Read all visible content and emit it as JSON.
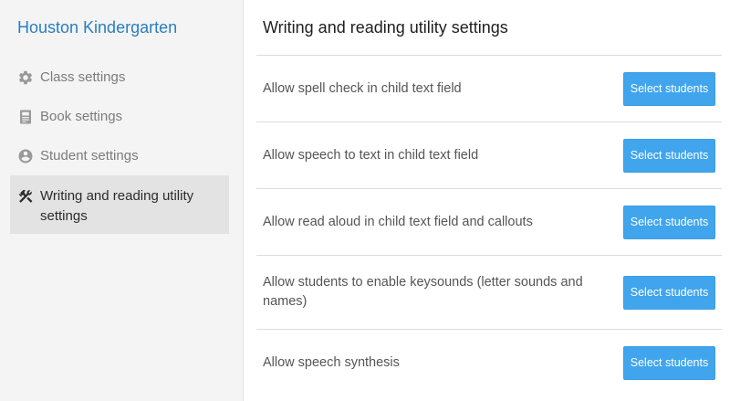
{
  "sidebar": {
    "school_name": "Houston Kindergarten",
    "items": [
      {
        "label": "Class settings",
        "icon": "gear-icon",
        "active": false
      },
      {
        "label": "Book settings",
        "icon": "book-icon",
        "active": false
      },
      {
        "label": "Student settings",
        "icon": "person-icon",
        "active": false
      },
      {
        "label": "Writing and reading utility settings",
        "icon": "tools-icon",
        "active": true
      }
    ]
  },
  "main": {
    "title": "Writing and reading utility settings",
    "settings": [
      {
        "label": "Allow spell check in child text field",
        "button": "Select students"
      },
      {
        "label": "Allow speech to text in child text field",
        "button": "Select students"
      },
      {
        "label": "Allow read aloud in child text field and callouts",
        "button": "Select students"
      },
      {
        "label": "Allow students to enable keysounds (letter sounds and names)",
        "button": "Select students"
      },
      {
        "label": "Allow speech synthesis",
        "button": "Select students"
      }
    ]
  },
  "colors": {
    "accent": "#2a7ec0",
    "button": "#40a5ec",
    "sidebar_bg": "#f4f4f4",
    "active_bg": "#e3e3e3"
  }
}
